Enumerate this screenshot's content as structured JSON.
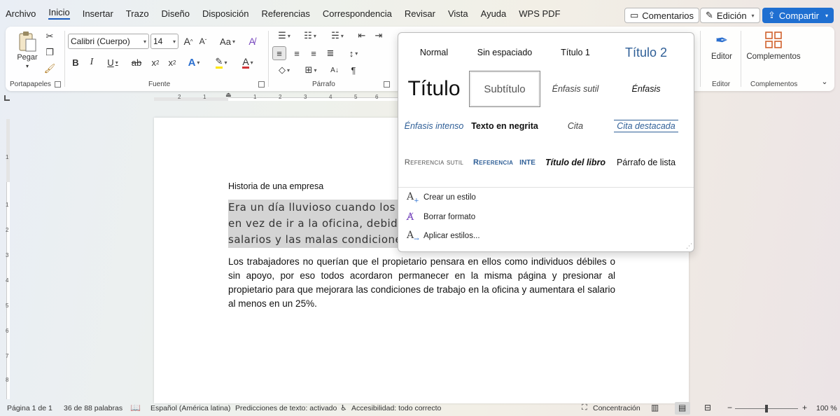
{
  "menu": {
    "items": [
      "Archivo",
      "Inicio",
      "Insertar",
      "Trazo",
      "Diseño",
      "Disposición",
      "Referencias",
      "Correspondencia",
      "Revisar",
      "Vista",
      "Ayuda",
      "WPS PDF"
    ],
    "active": "Inicio"
  },
  "top_buttons": {
    "comments": "Comentarios",
    "editing": "Edición",
    "share": "Compartir"
  },
  "ribbon": {
    "clipboard": {
      "paste": "Pegar",
      "label": "Portapapeles"
    },
    "font": {
      "name": "Calibri (Cuerpo)",
      "size": "14",
      "label": "Fuente",
      "case": "Aa"
    },
    "paragraph": {
      "label": "Párrafo"
    },
    "editor": {
      "button": "Editor",
      "label": "Editor"
    },
    "addins": {
      "button": "Complementos",
      "label": "Complementos"
    }
  },
  "ruler": {
    "h_marks": [
      "2",
      "1",
      "1",
      "2",
      "3",
      "4",
      "5",
      "6"
    ],
    "v_marks": [
      "1",
      "1",
      "2",
      "3",
      "4",
      "5",
      "6",
      "7",
      "8"
    ]
  },
  "document": {
    "title": "Historia de una empresa",
    "highlighted_lines": [
      "Era un día lluvioso cuando los",
      "en vez de ir a la oficina, debido",
      "salarios y las malas condicione"
    ],
    "paragraph": "Los trabajadores no querían que el propietario pensara en ellos como individuos débiles o sin apoyo, por eso todos acordaron permanecer en la misma página y presionar al propietario para que mejorara las condiciones de trabajo en la oficina y aumentara el salario al menos en un 25%."
  },
  "styles": {
    "items": [
      "Normal",
      "Sin espaciado",
      "Título 1",
      "Título 2",
      "Título",
      "Subtítulo",
      "Énfasis sutil",
      "Énfasis",
      "Énfasis intenso",
      "Texto en negrita",
      "Cita",
      "Cita destacada",
      "Referencia sutil",
      "Referencia",
      "Inte",
      "Título del libro",
      "Párrafo de lista"
    ],
    "selected": "Subtítulo",
    "actions": [
      "Crear un estilo",
      "Borrar formato",
      "Aplicar estilos..."
    ]
  },
  "status": {
    "page": "Página 1 de 1",
    "words": "36 de 88 palabras",
    "language": "Español (América latina)",
    "predictions": "Predicciones de texto: activado",
    "accessibility": "Accesibilidad: todo correcto",
    "focus": "Concentración",
    "zoom": "100 %",
    "zoom_minus": "−",
    "zoom_plus": "+"
  },
  "colors": {
    "accent": "#185abd",
    "share": "#1f6fd1",
    "highlight": "#d4d4d4",
    "font_color": "#d13438",
    "highlighter": "#ffe600"
  }
}
